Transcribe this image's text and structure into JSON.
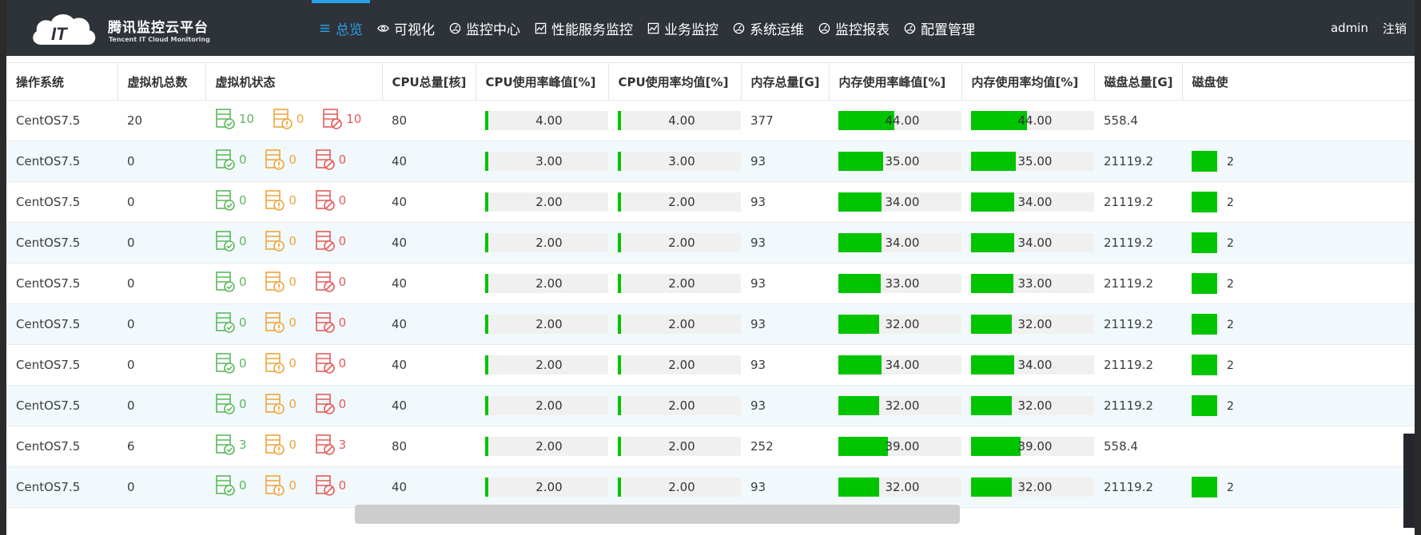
{
  "app": {
    "logo_text": "IT",
    "title": "腾讯监控云平台",
    "subtitle": "Tencent IT Cloud Monitoring"
  },
  "nav": {
    "items": [
      {
        "label": "总览",
        "icon": "list-icon",
        "active": true
      },
      {
        "label": "可视化",
        "icon": "eye-icon",
        "active": false
      },
      {
        "label": "监控中心",
        "icon": "gauge-icon",
        "active": false
      },
      {
        "label": "性能服务监控",
        "icon": "chart-icon",
        "active": false
      },
      {
        "label": "业务监控",
        "icon": "chart-icon",
        "active": false
      },
      {
        "label": "系统运维",
        "icon": "gauge-icon",
        "active": false
      },
      {
        "label": "监控报表",
        "icon": "gauge-icon",
        "active": false
      },
      {
        "label": "配置管理",
        "icon": "gauge-icon",
        "active": false
      }
    ],
    "user": "admin",
    "logout": "注销"
  },
  "colors": {
    "topbar": "#2e3239",
    "accent": "#29a0e8",
    "bar_fill": "#00c400",
    "state_ok": "#5cb85c",
    "state_warn": "#f0a43a",
    "state_err": "#e55b5b",
    "row_alt": "#f2f9fc"
  },
  "table": {
    "columns": [
      "操作系统",
      "虚拟机总数",
      "虚拟机状态",
      "CPU总量[核]",
      "CPU使用率峰值[%]",
      "CPU使用率均值[%]",
      "内存总量[G]",
      "内存使用率峰值[%]",
      "内存使用率均值[%]",
      "磁盘总量[G]",
      "磁盘使"
    ],
    "rows": [
      {
        "os": "CentOS7.5",
        "vm_total": "20",
        "ok": "10",
        "warn": "0",
        "err": "10",
        "cpu": "80",
        "cpu_peak": "4.00",
        "cpu_avg": "4.00",
        "mem": "377",
        "mem_peak": "44.00",
        "mem_avg": "44.00",
        "disk": "558.4",
        "disk_usage_shown": false,
        "disk_usage_cut": ""
      },
      {
        "os": "CentOS7.5",
        "vm_total": "0",
        "ok": "0",
        "warn": "0",
        "err": "0",
        "cpu": "40",
        "cpu_peak": "3.00",
        "cpu_avg": "3.00",
        "mem": "93",
        "mem_peak": "35.00",
        "mem_avg": "35.00",
        "disk": "21119.2",
        "disk_usage_shown": true,
        "disk_usage_cut": "2"
      },
      {
        "os": "CentOS7.5",
        "vm_total": "0",
        "ok": "0",
        "warn": "0",
        "err": "0",
        "cpu": "40",
        "cpu_peak": "2.00",
        "cpu_avg": "2.00",
        "mem": "93",
        "mem_peak": "34.00",
        "mem_avg": "34.00",
        "disk": "21119.2",
        "disk_usage_shown": true,
        "disk_usage_cut": "2"
      },
      {
        "os": "CentOS7.5",
        "vm_total": "0",
        "ok": "0",
        "warn": "0",
        "err": "0",
        "cpu": "40",
        "cpu_peak": "2.00",
        "cpu_avg": "2.00",
        "mem": "93",
        "mem_peak": "34.00",
        "mem_avg": "34.00",
        "disk": "21119.2",
        "disk_usage_shown": true,
        "disk_usage_cut": "2"
      },
      {
        "os": "CentOS7.5",
        "vm_total": "0",
        "ok": "0",
        "warn": "0",
        "err": "0",
        "cpu": "40",
        "cpu_peak": "2.00",
        "cpu_avg": "2.00",
        "mem": "93",
        "mem_peak": "33.00",
        "mem_avg": "33.00",
        "disk": "21119.2",
        "disk_usage_shown": true,
        "disk_usage_cut": "2"
      },
      {
        "os": "CentOS7.5",
        "vm_total": "0",
        "ok": "0",
        "warn": "0",
        "err": "0",
        "cpu": "40",
        "cpu_peak": "2.00",
        "cpu_avg": "2.00",
        "mem": "93",
        "mem_peak": "32.00",
        "mem_avg": "32.00",
        "disk": "21119.2",
        "disk_usage_shown": true,
        "disk_usage_cut": "2"
      },
      {
        "os": "CentOS7.5",
        "vm_total": "0",
        "ok": "0",
        "warn": "0",
        "err": "0",
        "cpu": "40",
        "cpu_peak": "2.00",
        "cpu_avg": "2.00",
        "mem": "93",
        "mem_peak": "34.00",
        "mem_avg": "34.00",
        "disk": "21119.2",
        "disk_usage_shown": true,
        "disk_usage_cut": "2"
      },
      {
        "os": "CentOS7.5",
        "vm_total": "0",
        "ok": "0",
        "warn": "0",
        "err": "0",
        "cpu": "40",
        "cpu_peak": "2.00",
        "cpu_avg": "2.00",
        "mem": "93",
        "mem_peak": "32.00",
        "mem_avg": "32.00",
        "disk": "21119.2",
        "disk_usage_shown": true,
        "disk_usage_cut": "2"
      },
      {
        "os": "CentOS7.5",
        "vm_total": "6",
        "ok": "3",
        "warn": "0",
        "err": "3",
        "cpu": "80",
        "cpu_peak": "2.00",
        "cpu_avg": "2.00",
        "mem": "252",
        "mem_peak": "39.00",
        "mem_avg": "39.00",
        "disk": "558.4",
        "disk_usage_shown": false,
        "disk_usage_cut": ""
      },
      {
        "os": "CentOS7.5",
        "vm_total": "0",
        "ok": "0",
        "warn": "0",
        "err": "0",
        "cpu": "40",
        "cpu_peak": "2.00",
        "cpu_avg": "2.00",
        "mem": "93",
        "mem_peak": "32.00",
        "mem_avg": "32.00",
        "disk": "21119.2",
        "disk_usage_shown": true,
        "disk_usage_cut": "2"
      }
    ]
  }
}
